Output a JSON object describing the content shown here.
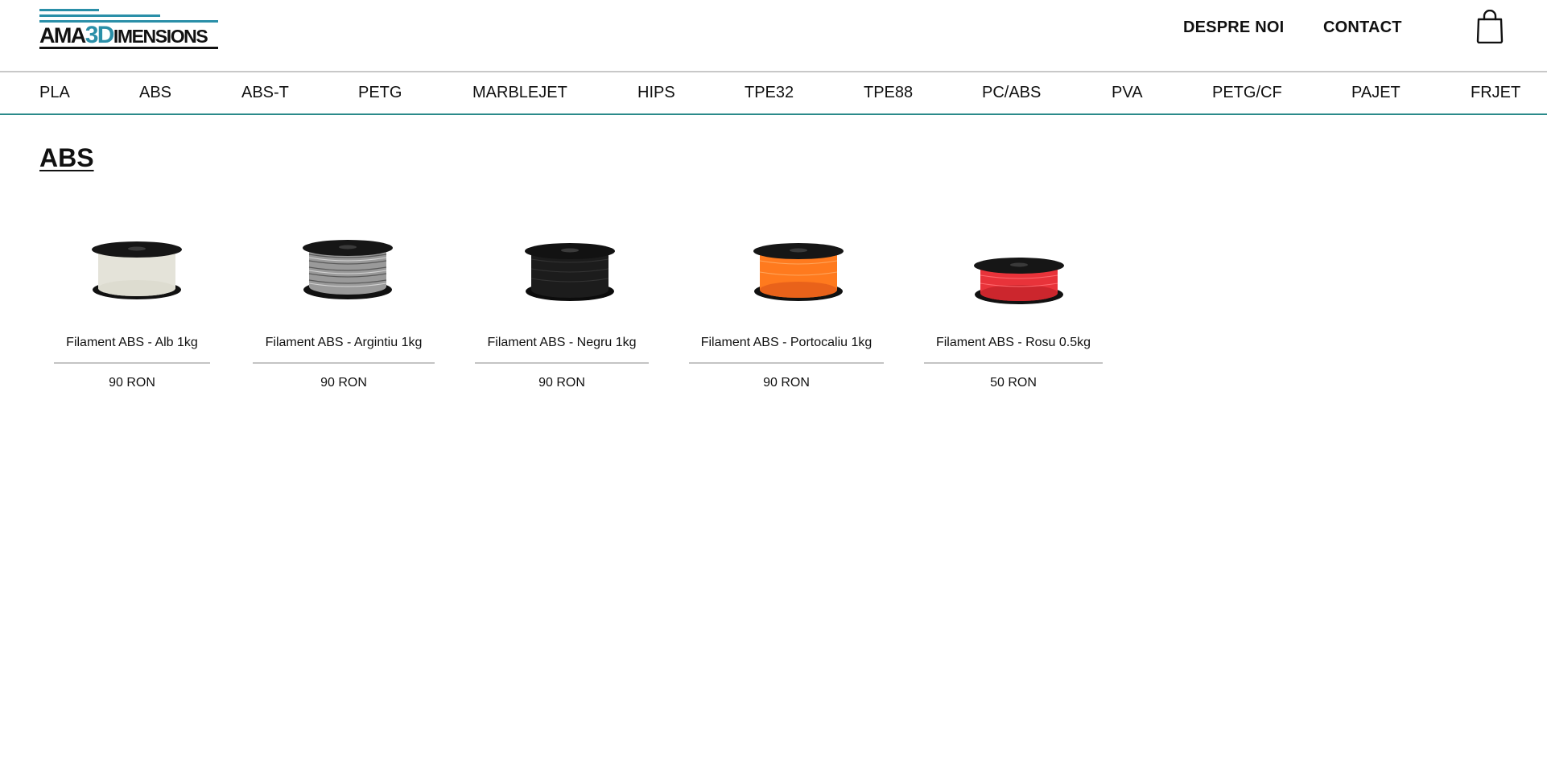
{
  "header": {
    "logo_text": {
      "part1": "AMA",
      "part2": "3D",
      "part3": "IMENSIONS"
    },
    "nav_links": [
      "DESPRE NOI",
      "CONTACT"
    ],
    "cart_icon": "shopping-bag-icon",
    "brand_color": "#2a8fa8"
  },
  "categories": [
    "PLA",
    "ABS",
    "ABS-T",
    "PETG",
    "MARBLEJET",
    "HIPS",
    "TPE32",
    "TPE88",
    "PC/ABS",
    "PVA",
    "PETG/CF",
    "PAJET",
    "FRJET"
  ],
  "page": {
    "title": "ABS"
  },
  "products": [
    {
      "name": "Filament ABS - Alb 1kg",
      "price": "90 RON",
      "color": "#ecebe2",
      "image": "filament-spool-white"
    },
    {
      "name": "Filament ABS - Argintiu 1kg",
      "price": "90 RON",
      "color": "#9a9a9a",
      "image": "filament-spool-silver"
    },
    {
      "name": "Filament ABS - Negru 1kg",
      "price": "90 RON",
      "color": "#1c1c1c",
      "image": "filament-spool-black"
    },
    {
      "name": "Filament ABS - Portocaliu 1kg",
      "price": "90 RON",
      "color": "#ff7a1e",
      "image": "filament-spool-orange"
    },
    {
      "name": "Filament ABS - Rosu 0.5kg",
      "price": "50 RON",
      "color": "#e8333a",
      "image": "filament-spool-red"
    }
  ]
}
